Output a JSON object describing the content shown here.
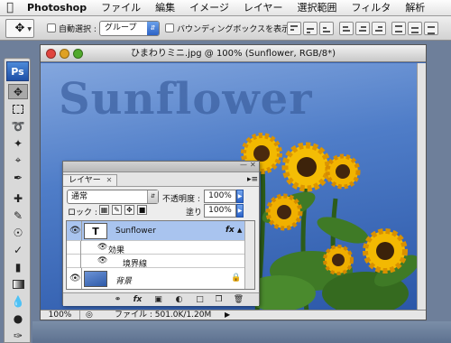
{
  "menubar": {
    "app_name": "Photoshop",
    "items": [
      "ファイル",
      "編集",
      "イメージ",
      "レイヤー",
      "選択範囲",
      "フィルタ",
      "解析"
    ]
  },
  "options": {
    "auto_select_label": "自動選択 :",
    "auto_select_value": "グループ",
    "bounding_box_label": "バウンディングボックスを表示"
  },
  "tools": {
    "logo": "Ps"
  },
  "document": {
    "title": "ひまわりミニ.jpg @ 100% (Sunflower, RGB/8*)",
    "canvas_text": "Sunflower",
    "zoom": "100%",
    "file_info": "ファイル : 501.0K/1.20M"
  },
  "layers_panel": {
    "tab_label": "レイヤー",
    "blend_mode": "通常",
    "opacity_label": "不透明度 :",
    "opacity_value": "100%",
    "lock_label": "ロック :",
    "fill_label": "塗り :",
    "fill_value": "100%",
    "layers": [
      {
        "name": "Sunflower",
        "thumb": "T",
        "fx": "fx"
      },
      {
        "name": "背景"
      }
    ],
    "effects_label": "効果",
    "stroke_effect": "境界線",
    "bottom_fx": "fx"
  }
}
